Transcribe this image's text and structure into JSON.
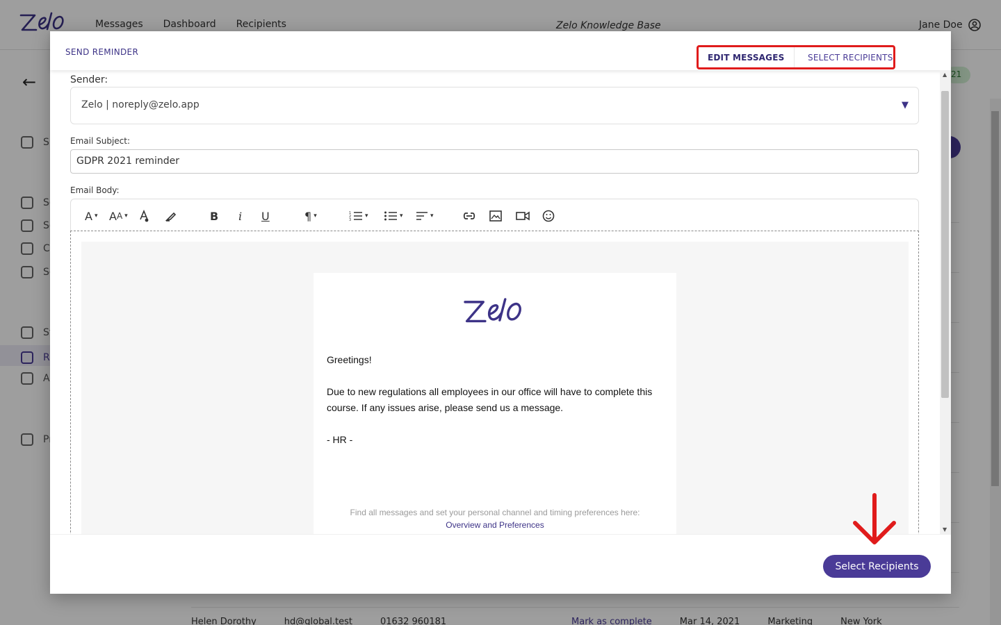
{
  "app": {
    "nav": [
      "Messages",
      "Dashboard",
      "Recipients"
    ],
    "knowledge_base": "Zelo Knowledge Base",
    "user": "Jane Doe",
    "badge": "21",
    "sidebar_letters": [
      "Su",
      "Se",
      "Se",
      "Co",
      "Sc",
      "St",
      "Re",
      "Ad",
      "Pr"
    ],
    "bg_row": {
      "name": "Helen Dorothy",
      "email": "hd@global.test",
      "phone": "01632 960181",
      "action": "Mark as complete",
      "date": "Mar 14, 2021",
      "dept": "Marketing",
      "city": "New York"
    }
  },
  "modal": {
    "title": "SEND REMINDER",
    "tabs": [
      "EDIT MESSAGES",
      "SELECT RECIPIENTS"
    ],
    "sender_label": "Sender:",
    "sender_value": "Zelo | noreply@zelo.app",
    "subject_label": "Email Subject:",
    "subject_value": "GDPR 2021 reminder",
    "body_label": "Email Body:",
    "toolbar": [
      "font-color-icon",
      "font-size-icon",
      "text-color-icon",
      "highlight-icon",
      "bold-icon",
      "italic-icon",
      "underline-icon",
      "paragraph-icon",
      "ordered-list-icon",
      "unordered-list-icon",
      "align-icon",
      "link-icon",
      "image-icon",
      "video-icon",
      "emoji-icon"
    ],
    "email": {
      "greeting": "Greetings!",
      "paragraph": "Due to new regulations all employees in our office will have to complete this course. If any issues arise, please send us a message.",
      "signoff": "- HR -",
      "footer": "Find all messages and set your personal channel and timing preferences here:",
      "footer_link": "Overview and Preferences"
    },
    "primary_button": "Select Recipients"
  },
  "colors": {
    "brand": "#4a3b97",
    "annotation": "#e01b1b"
  }
}
